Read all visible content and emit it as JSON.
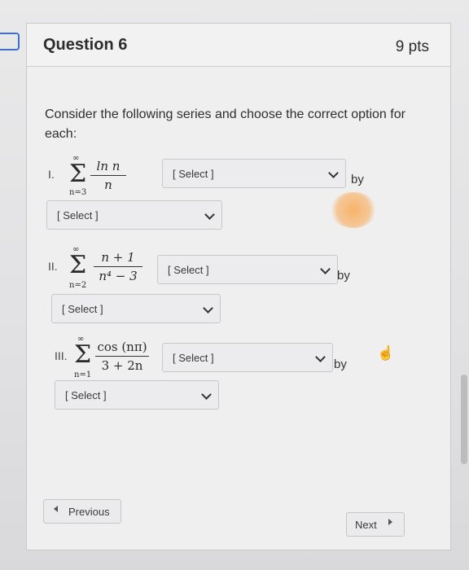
{
  "question": {
    "title": "Question 6",
    "points": "9 pts",
    "prompt": "Consider the following series and choose the correct option for each:"
  },
  "series": [
    {
      "numeral": "I.",
      "sum_upper": "∞",
      "sum_lower": "n=3",
      "numerator": "ln n",
      "denominator": "n",
      "select_a": "[ Select ]",
      "by_label": "by",
      "select_b": "[ Select ]"
    },
    {
      "numeral": "II.",
      "sum_upper": "∞",
      "sum_lower": "n=2",
      "numerator": "n + 1",
      "denominator": "n⁴ − 3",
      "select_a": "[ Select ]",
      "by_label": "by",
      "select_b": "[ Select ]"
    },
    {
      "numeral": "III.",
      "sum_upper": "∞",
      "sum_lower": "n=1",
      "numerator": "cos (nπ)",
      "denominator": "3 + 2n",
      "select_a": "[ Select ]",
      "by_label": "by",
      "select_b": "[ Select ]"
    }
  ],
  "nav": {
    "previous_label": "Previous",
    "next_label": "Next"
  },
  "icons": {
    "flag": "bookmark-flag-icon",
    "cursor": "hand-pointer-icon",
    "chevron": "chevron-down-icon"
  },
  "colors": {
    "accent": "#3a6fd6"
  }
}
